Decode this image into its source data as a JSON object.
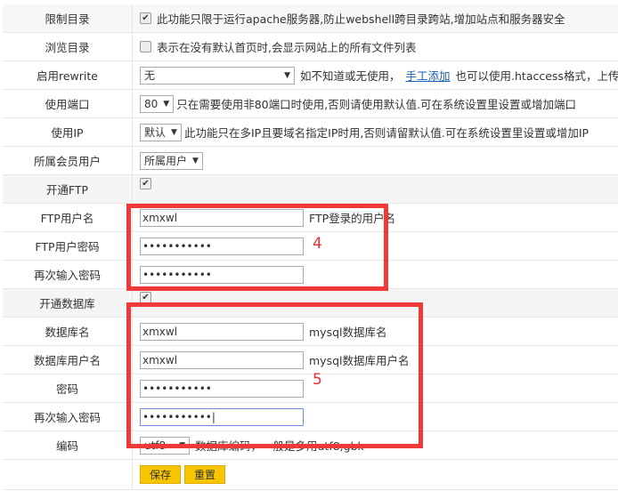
{
  "rows": {
    "restrict_dir": {
      "label": "限制目录",
      "checked": true,
      "desc": "此功能只限于运行apache服务器,防止webshell跨目录跨站,增加站点和服务器安全"
    },
    "browse_dir": {
      "label": "浏览目录",
      "checked": false,
      "desc": "表示在没有默认首页时,会显示网站上的所有文件列表"
    },
    "rewrite": {
      "label": "启用rewrite",
      "value": "无",
      "desc1": "如不知道或无使用，",
      "link": "手工添加",
      "desc2": "也可以使用.htaccess格式，上传"
    },
    "port": {
      "label": "使用端口",
      "value": "80",
      "desc": "只在需要使用非80端口时使用,否则请使用默认值.可在系统设置里设置或增加端口"
    },
    "ip": {
      "label": "使用IP",
      "value": "默认",
      "desc": "此功能只在多IP且要域名指定IP时用,否则请留默认值.可在系统设置里设置或增加IP"
    },
    "member": {
      "label": "所属会员用户",
      "value": "所属用户"
    },
    "ftp_enable": {
      "label": "开通FTP",
      "checked": true
    },
    "ftp_user": {
      "label": "FTP用户名",
      "value": "xmxwl",
      "desc": "FTP登录的用户名"
    },
    "ftp_pass": {
      "label": "FTP用户密码",
      "value": "•••••••••••"
    },
    "ftp_pass2": {
      "label": "再次输入密码",
      "value": "•••••••••••"
    },
    "db_enable": {
      "label": "开通数据库",
      "checked": true
    },
    "db_name": {
      "label": "数据库名",
      "value": "xmxwl",
      "desc": "mysql数据库名"
    },
    "db_user": {
      "label": "数据库用户名",
      "value": "xmxwl",
      "desc": "mysql数据库用户名"
    },
    "db_pass": {
      "label": "密码",
      "value": "•••••••••••"
    },
    "db_pass2": {
      "label": "再次输入密码",
      "value": "•••••••••••|"
    },
    "charset": {
      "label": "编码",
      "value": "utf8",
      "desc": "数据库编码，一般是多用utf8,gbk"
    }
  },
  "buttons": {
    "save": "保存",
    "reset": "重置"
  },
  "annotations": {
    "box4": "4",
    "box5": "5"
  },
  "colors": {
    "annotation": "#f03a3a",
    "button": "#f7c600"
  }
}
